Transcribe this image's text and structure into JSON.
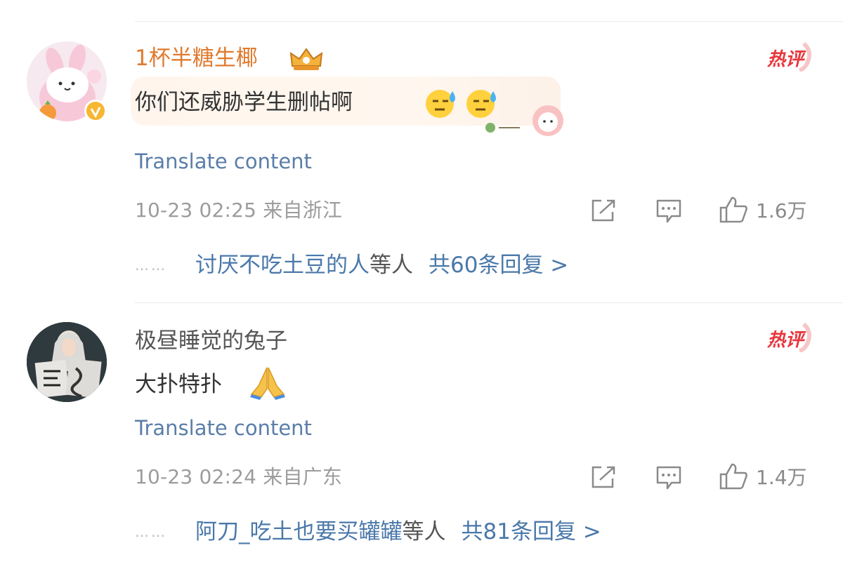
{
  "comments": [
    {
      "username": "1杯半糖生椰",
      "username_color": "#e07a2e",
      "verified": true,
      "badge": "热评",
      "text": "你们还威胁学生删帖啊",
      "emojis": [
        "sweat-emoji",
        "sweat-emoji"
      ],
      "translate": "Translate content",
      "time": "10-23 02:25",
      "location": "来自浙江",
      "likes": "1.6万",
      "replies": {
        "dots": "……",
        "names": "讨厌不吃土豆的人",
        "suffix": "等人",
        "total": "共60条回复 >"
      }
    },
    {
      "username": "极昼睡觉的兔子",
      "username_color": "#555555",
      "verified": false,
      "badge": "热评",
      "text": "大扑特扑",
      "emojis": [
        "praying-hands-emoji"
      ],
      "translate": "Translate content",
      "time": "10-23 02:24",
      "location": "来自广东",
      "likes": "1.4万",
      "replies": {
        "dots": "……",
        "names": "阿刀_吃土也要买罐罐",
        "suffix": "等人",
        "total": "共81条回复 >"
      }
    }
  ],
  "colors": {
    "link": "#4a78aa",
    "meta": "#9c9c9c",
    "badge": "#e8363c"
  }
}
